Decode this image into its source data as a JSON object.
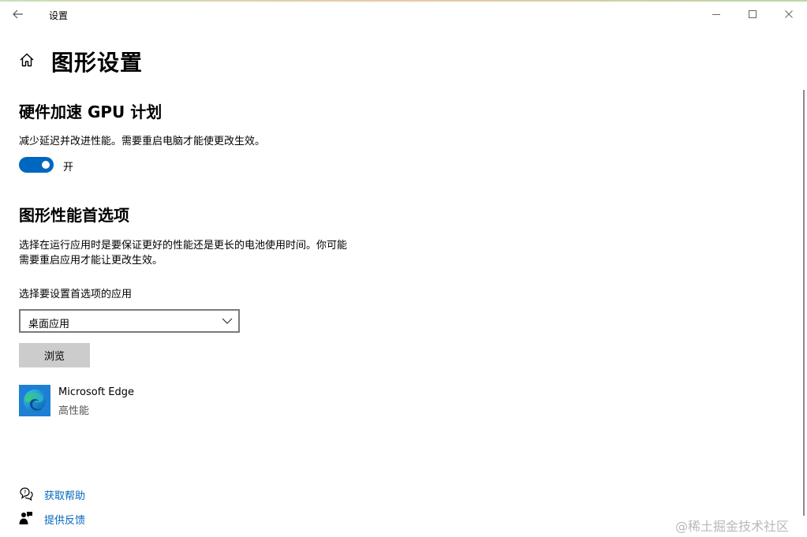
{
  "window": {
    "title": "设置",
    "icons": {
      "back": "back-arrow-icon",
      "minimize": "minimize-icon",
      "maximize": "maximize-icon",
      "close": "close-icon"
    }
  },
  "page": {
    "title": "图形设置",
    "home_icon": "home-icon"
  },
  "gpu_scheduling": {
    "title": "硬件加速 GPU 计划",
    "description": "减少延迟并改进性能。需要重启电脑才能使更改生效。",
    "toggle_state": "开",
    "toggle_on": true,
    "accent_color": "#0067c0"
  },
  "graphics_preference": {
    "title": "图形性能首选项",
    "description_line1": "选择在运行应用时是要保证更好的性能还是更长的电池使用时间。你可能",
    "description_line2": "需要重启应用才能让更改生效。",
    "select_label": "选择要设置首选项的应用",
    "select_value": "桌面应用",
    "browse_label": "浏览"
  },
  "apps": [
    {
      "name": "Microsoft Edge",
      "preference": "高性能",
      "icon": "edge-icon"
    }
  ],
  "links": {
    "help": {
      "label": "获取帮助",
      "icon": "help-chat-icon"
    },
    "feedback": {
      "label": "提供反馈",
      "icon": "feedback-icon"
    }
  },
  "watermark": "@稀土掘金技术社区"
}
